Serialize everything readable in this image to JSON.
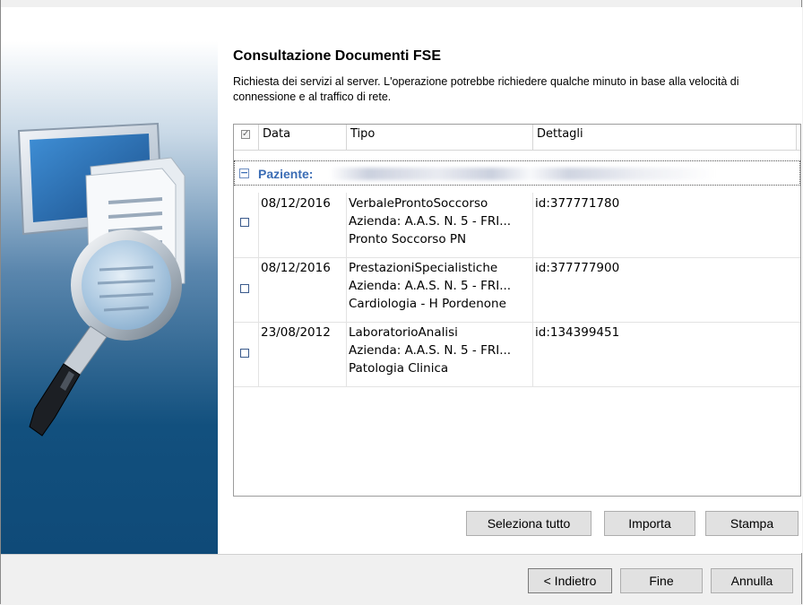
{
  "header": {
    "title": "Consultazione Documenti FSE",
    "description": "Richiesta dei servizi al server. L'operazione potrebbe richiedere qualche minuto in base alla velocità di connessione e al traffico di rete."
  },
  "grid": {
    "columns": [
      "Data",
      "Tipo",
      "Dettagli"
    ],
    "group_label": "Paziente:",
    "rows": [
      {
        "date": "08/12/2016",
        "tipo": [
          "VerbaleProntoSoccorso",
          "Azienda: A.A.S. N. 5 - FRI...",
          "Pronto Soccorso PN"
        ],
        "dettagli": "id:377771780"
      },
      {
        "date": "08/12/2016",
        "tipo": [
          "PrestazioniSpecialistiche",
          "Azienda: A.A.S. N. 5 - FRI...",
          "Cardiologia - H Pordenone"
        ],
        "dettagli": "id:377777900"
      },
      {
        "date": "23/08/2012",
        "tipo": [
          "LaboratorioAnalisi",
          "Azienda: A.A.S. N. 5 - FRI...",
          "Patologia Clinica"
        ],
        "dettagli": "id:134399451"
      }
    ]
  },
  "actions": {
    "select_all": "Seleziona tutto",
    "import": "Importa",
    "print": "Stampa"
  },
  "footer": {
    "back": "< Indietro",
    "finish": "Fine",
    "cancel": "Annulla"
  },
  "colors": {
    "group_text": "#3b6db5",
    "button_bg": "#e1e1e1",
    "panel_bg": "#f0f0f0"
  },
  "icons": {
    "wizard_art": "magnifier-document-monitor-icon"
  }
}
